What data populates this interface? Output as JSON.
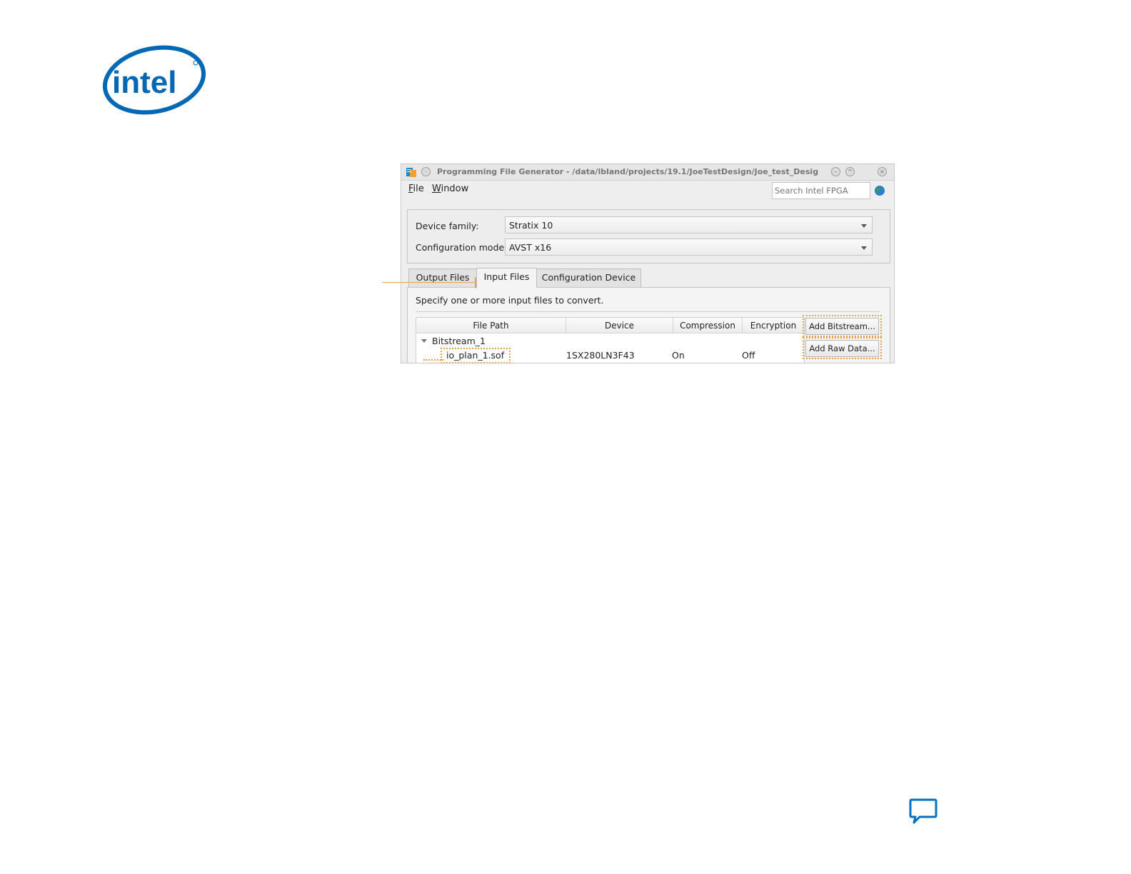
{
  "window": {
    "title": "Programming File Generator - /data/lbland/projects/19.1/JoeTestDesign/Joe_test_Desig"
  },
  "menu": {
    "file": "File",
    "window": "Window"
  },
  "search": {
    "placeholder": "Search Intel FPGA"
  },
  "device": {
    "family_label": "Device family:",
    "family_value": "Stratix 10",
    "mode_label": "Configuration mode:",
    "mode_value": "AVST x16"
  },
  "tabs": [
    {
      "label": "Output Files"
    },
    {
      "label": "Input Files",
      "active": true
    },
    {
      "label": "Configuration Device"
    }
  ],
  "input_panel": {
    "hint": "Specify one or more input files to convert.",
    "columns": [
      "File Path",
      "Device",
      "Compression",
      "Encryption"
    ],
    "group": "Bitstream_1",
    "row": {
      "file": "io_plan_1.sof",
      "device": "1SX280LN3F43",
      "compression": "On",
      "encryption": "Off"
    }
  },
  "buttons": {
    "add_bitstream": "Add Bitstream...",
    "add_raw_data": "Add Raw Data..."
  },
  "colors": {
    "intel_blue": "#0068b5",
    "highlight": "#e8a04a",
    "feedback_blue": "#0071c5"
  },
  "icons": {
    "logo": "intel-logo",
    "app": "programming-file-generator-icon",
    "globe": "globe-icon",
    "feedback": "speech-bubble-icon"
  }
}
